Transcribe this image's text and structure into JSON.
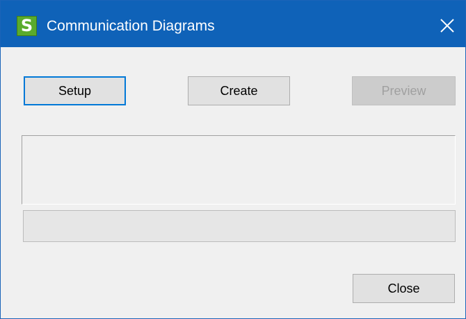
{
  "window": {
    "title": "Communication Diagrams",
    "app_icon_letter": "S",
    "close_icon": "close-icon"
  },
  "buttons": {
    "setup_label": "Setup",
    "create_label": "Create",
    "preview_label": "Preview",
    "preview_enabled": false,
    "close_label": "Close"
  },
  "output": {
    "text": ""
  },
  "progress": {
    "value": 0
  },
  "colors": {
    "titlebar": "#0f62b8",
    "app_icon": "#5aab2c",
    "default_button_border": "#0078d7",
    "window_background": "#f0f0f0"
  }
}
